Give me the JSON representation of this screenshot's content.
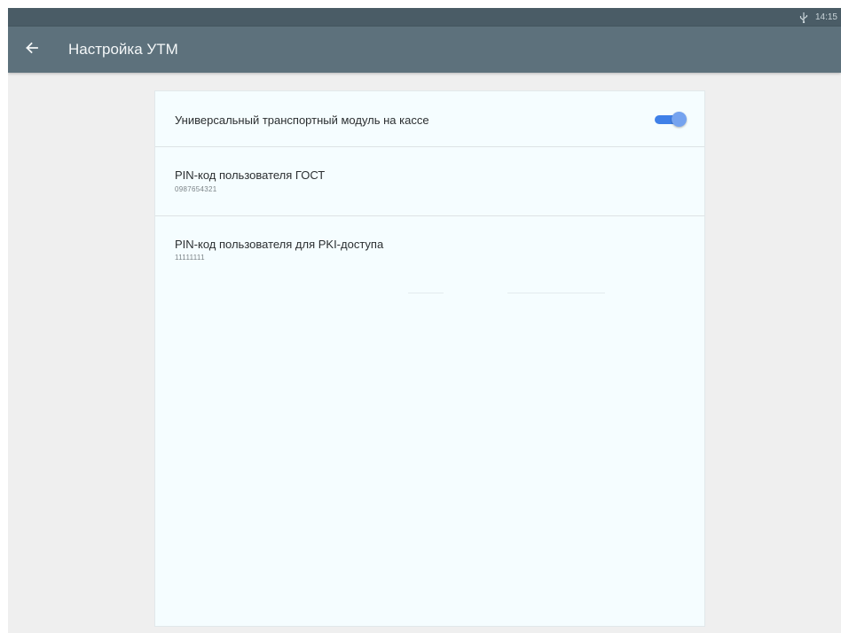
{
  "status_bar": {
    "time": "14:15",
    "icons": [
      "usb-icon"
    ],
    "color": "#4a5c66"
  },
  "app_bar": {
    "title": "Настройка УТМ",
    "back_icon": "arrow-left-icon",
    "color": "#5d717c"
  },
  "settings": {
    "items": [
      {
        "title": "Универсальный транспортный модуль на кассе",
        "toggle": true
      },
      {
        "title": "PIN-код пользователя ГОСТ",
        "summary": "0987654321"
      },
      {
        "title": "PIN-код пользователя для PKI-доступа",
        "summary": "11111111"
      }
    ]
  },
  "colors": {
    "toggle_accent": "#3f80e8",
    "card_background": "#f5fdff",
    "page_background": "#efefef"
  }
}
